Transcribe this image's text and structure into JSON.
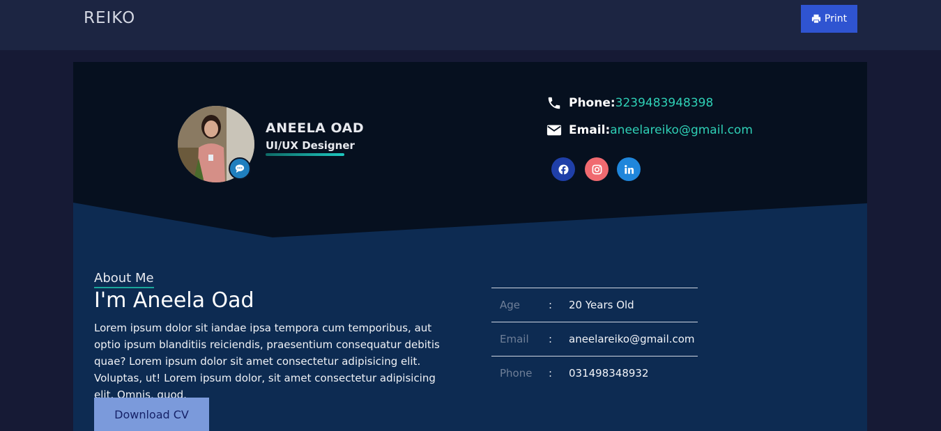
{
  "header": {
    "brand": "REIKO",
    "print_label": "Print",
    "print_icon": "print-icon"
  },
  "profile": {
    "name": "ANEELA OAD",
    "role": "UI/UX Designer",
    "avatar_icon": "chat-icon"
  },
  "contact": {
    "phone_label": "Phone:",
    "phone_value": "3239483948398",
    "email_label": "Email:",
    "email_value": "aneelareiko@gmail.com"
  },
  "social": [
    {
      "icon": "facebook-icon",
      "color": "#1f3fa8"
    },
    {
      "icon": "instagram-icon",
      "color": "#f06a70"
    },
    {
      "icon": "linkedin-icon",
      "color": "#1f86db"
    }
  ],
  "about": {
    "label": "About Me",
    "title": "I'm Aneela Oad",
    "text": "Lorem ipsum dolor sit iandae ipsa tempora cum temporibus, aut optio ipsum blanditiis reiciendis, praesentium consequatur debitis quae? Lorem ipsum dolor sit amet consectetur adipisicing elit. Voluptas, ut! Lorem ipsum dolor, sit amet consectetur adipisicing elit. Omnis, quod.",
    "download_label": "Download CV"
  },
  "info": [
    {
      "key": "Age",
      "sep": ":",
      "value": "20 Years Old"
    },
    {
      "key": "Email",
      "sep": ":",
      "value": "aneelareiko@gmail.com"
    },
    {
      "key": "Phone",
      "sep": ":",
      "value": "031498348932"
    }
  ],
  "colors": {
    "accent_teal": "#2fd0b6",
    "print_button": "#2f54d1",
    "download_button": "#7b9adb",
    "hero_dark": "#06101f",
    "card_blue": "#0d2b52"
  }
}
